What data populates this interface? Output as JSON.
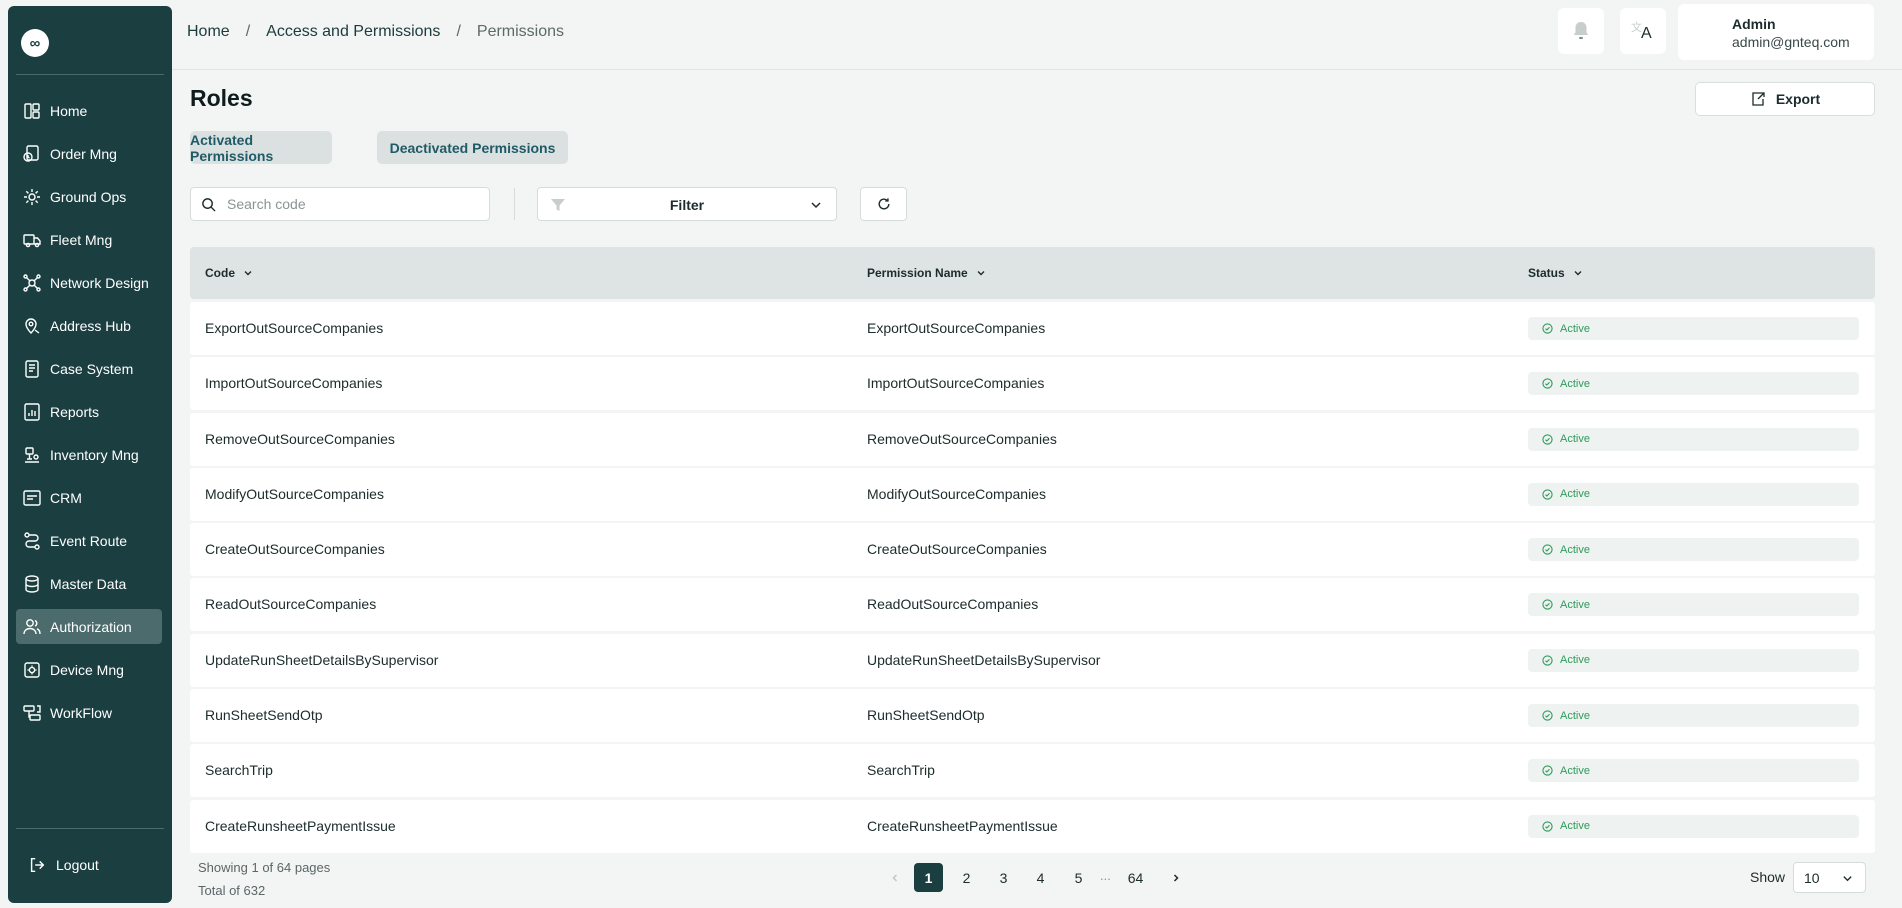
{
  "sidebar": {
    "logo_glyph": "∞",
    "items": [
      {
        "label": "Home",
        "icon": "dashboard-icon",
        "active": false
      },
      {
        "label": "Order Mng",
        "icon": "order-icon",
        "active": false
      },
      {
        "label": "Ground Ops",
        "icon": "ground-ops-icon",
        "active": false
      },
      {
        "label": "Fleet Mng",
        "icon": "truck-icon",
        "active": false
      },
      {
        "label": "Network Design",
        "icon": "network-icon",
        "active": false
      },
      {
        "label": "Address Hub",
        "icon": "location-icon",
        "active": false
      },
      {
        "label": "Case System",
        "icon": "case-icon",
        "active": false
      },
      {
        "label": "Reports",
        "icon": "report-icon",
        "active": false
      },
      {
        "label": "Inventory Mng",
        "icon": "inventory-icon",
        "active": false
      },
      {
        "label": "CRM",
        "icon": "crm-icon",
        "active": false
      },
      {
        "label": "Event Route",
        "icon": "route-icon",
        "active": false
      },
      {
        "label": "Master Data",
        "icon": "database-icon",
        "active": false
      },
      {
        "label": "Authorization",
        "icon": "users-icon",
        "active": true
      },
      {
        "label": "Device Mng",
        "icon": "device-icon",
        "active": false
      },
      {
        "label": "WorkFlow",
        "icon": "workflow-icon",
        "active": false
      }
    ],
    "logout_label": "Logout"
  },
  "breadcrumb": [
    "Home",
    "Access and Permissions",
    "Permissions"
  ],
  "breadcrumb_separator": "/",
  "user": {
    "name": "Admin",
    "email": "admin@gnteq.com"
  },
  "header": {
    "language_glyph": "A"
  },
  "page": {
    "title": "Roles",
    "export_label": "Export",
    "tabs": [
      "Activated Permissions",
      "Deactivated Permissions"
    ],
    "search_placeholder": "Search code",
    "filter_label": "Filter"
  },
  "table": {
    "columns": [
      "Code",
      "Permission Name",
      "Status"
    ],
    "rows": [
      {
        "code": "ExportOutSourceCompanies",
        "name": "ExportOutSourceCompanies",
        "status": "Active"
      },
      {
        "code": "ImportOutSourceCompanies",
        "name": "ImportOutSourceCompanies",
        "status": "Active"
      },
      {
        "code": "RemoveOutSourceCompanies",
        "name": "RemoveOutSourceCompanies",
        "status": "Active"
      },
      {
        "code": "ModifyOutSourceCompanies",
        "name": "ModifyOutSourceCompanies",
        "status": "Active"
      },
      {
        "code": "CreateOutSourceCompanies",
        "name": "CreateOutSourceCompanies",
        "status": "Active"
      },
      {
        "code": "ReadOutSourceCompanies",
        "name": "ReadOutSourceCompanies",
        "status": "Active"
      },
      {
        "code": "UpdateRunSheetDetailsBySupervisor",
        "name": "UpdateRunSheetDetailsBySupervisor",
        "status": "Active"
      },
      {
        "code": "RunSheetSendOtp",
        "name": "RunSheetSendOtp",
        "status": "Active"
      },
      {
        "code": "SearchTrip",
        "name": "SearchTrip",
        "status": "Active"
      },
      {
        "code": "CreateRunsheetPaymentIssue",
        "name": "CreateRunsheetPaymentIssue",
        "status": "Active"
      }
    ]
  },
  "footer": {
    "showing": "Showing 1 of 64 pages",
    "total": "Total of 632",
    "pages": [
      "1",
      "2",
      "3",
      "4",
      "5"
    ],
    "ellipsis": "...",
    "last_page": "64",
    "current_page": "1",
    "show_label": "Show",
    "page_size": "10"
  },
  "colors": {
    "sidebar_bg": "#1b3e40",
    "active_item": "#4c6b6c",
    "status_active": "#2f9a5a",
    "tab_text": "#1f5b66"
  }
}
